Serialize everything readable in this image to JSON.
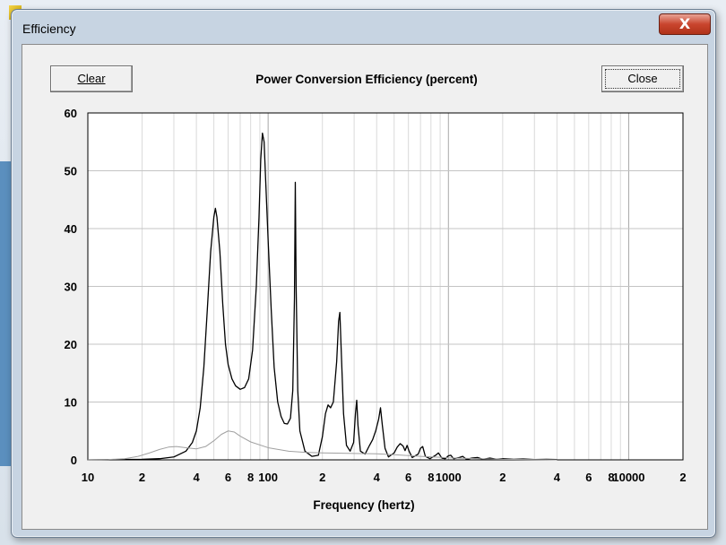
{
  "window": {
    "title": "Efficiency",
    "close_glyph": "X"
  },
  "toolbar": {
    "clear_label": "Clear",
    "close_label": "Close"
  },
  "chart_data": {
    "type": "line",
    "title": "Power Conversion Efficiency (percent)",
    "xlabel": "Frequency (hertz)",
    "ylabel": "",
    "xscale": "log",
    "xlim": [
      10,
      20000
    ],
    "ylim": [
      0,
      60
    ],
    "grid": true,
    "y_ticks": [
      "0",
      "10",
      "20",
      "30",
      "40",
      "50",
      "60"
    ],
    "x_ticks": [
      {
        "value": 10,
        "label": "10"
      },
      {
        "value": 20,
        "label": "2"
      },
      {
        "value": 40,
        "label": "4"
      },
      {
        "value": 60,
        "label": "6"
      },
      {
        "value": 80,
        "label": "8"
      },
      {
        "value": 100,
        "label": "100"
      },
      {
        "value": 200,
        "label": "2"
      },
      {
        "value": 400,
        "label": "4"
      },
      {
        "value": 600,
        "label": "6"
      },
      {
        "value": 800,
        "label": "8"
      },
      {
        "value": 1000,
        "label": "1000"
      },
      {
        "value": 2000,
        "label": "2"
      },
      {
        "value": 4000,
        "label": "4"
      },
      {
        "value": 6000,
        "label": "6"
      },
      {
        "value": 8000,
        "label": "8"
      },
      {
        "value": 10000,
        "label": "10000"
      },
      {
        "value": 20000,
        "label": "2"
      }
    ],
    "series": [
      {
        "color": "#000000",
        "points": [
          [
            10,
            0
          ],
          [
            20,
            0.1
          ],
          [
            25,
            0.2
          ],
          [
            30,
            0.5
          ],
          [
            35,
            1.5
          ],
          [
            38,
            3
          ],
          [
            40,
            5
          ],
          [
            42,
            9
          ],
          [
            44,
            16
          ],
          [
            46,
            26
          ],
          [
            48,
            36
          ],
          [
            50,
            42
          ],
          [
            51,
            43.5
          ],
          [
            52,
            42
          ],
          [
            54,
            36
          ],
          [
            56,
            27
          ],
          [
            58,
            20
          ],
          [
            60,
            16.5
          ],
          [
            63,
            14
          ],
          [
            66,
            12.8
          ],
          [
            70,
            12.2
          ],
          [
            74,
            12.5
          ],
          [
            78,
            14
          ],
          [
            82,
            19
          ],
          [
            86,
            30
          ],
          [
            89,
            42
          ],
          [
            91,
            52
          ],
          [
            93,
            56.5
          ],
          [
            95,
            55
          ],
          [
            97,
            48
          ],
          [
            100,
            38
          ],
          [
            104,
            26
          ],
          [
            108,
            16
          ],
          [
            113,
            10
          ],
          [
            118,
            7.5
          ],
          [
            123,
            6.3
          ],
          [
            128,
            6.2
          ],
          [
            133,
            7.2
          ],
          [
            137,
            12
          ],
          [
            140,
            28
          ],
          [
            141.5,
            48
          ],
          [
            143,
            30
          ],
          [
            146,
            12
          ],
          [
            150,
            5
          ],
          [
            160,
            1.5
          ],
          [
            175,
            0.6
          ],
          [
            190,
            0.8
          ],
          [
            200,
            4
          ],
          [
            208,
            8
          ],
          [
            215,
            9.5
          ],
          [
            222,
            9
          ],
          [
            230,
            10
          ],
          [
            240,
            17
          ],
          [
            246,
            24
          ],
          [
            250,
            25.5
          ],
          [
            255,
            18
          ],
          [
            262,
            8
          ],
          [
            272,
            2.5
          ],
          [
            285,
            1.5
          ],
          [
            298,
            3
          ],
          [
            305,
            8
          ],
          [
            310,
            10.3
          ],
          [
            315,
            6
          ],
          [
            325,
            1.5
          ],
          [
            345,
            1
          ],
          [
            365,
            2.5
          ],
          [
            380,
            3.5
          ],
          [
            395,
            5
          ],
          [
            410,
            7
          ],
          [
            420,
            9
          ],
          [
            430,
            6
          ],
          [
            445,
            2
          ],
          [
            465,
            0.5
          ],
          [
            500,
            1.2
          ],
          [
            520,
            2.2
          ],
          [
            540,
            2.8
          ],
          [
            560,
            2.4
          ],
          [
            575,
            1.6
          ],
          [
            590,
            2.5
          ],
          [
            605,
            1.5
          ],
          [
            630,
            0.4
          ],
          [
            680,
            1
          ],
          [
            700,
            2
          ],
          [
            720,
            2.3
          ],
          [
            745,
            0.6
          ],
          [
            790,
            0.2
          ],
          [
            850,
            0.8
          ],
          [
            880,
            1.2
          ],
          [
            920,
            0.3
          ],
          [
            960,
            0.2
          ],
          [
            1000,
            0.7
          ],
          [
            1030,
            0.8
          ],
          [
            1070,
            0.2
          ],
          [
            1150,
            0.4
          ],
          [
            1200,
            0.6
          ],
          [
            1260,
            0.1
          ],
          [
            1350,
            0.3
          ],
          [
            1450,
            0.4
          ],
          [
            1550,
            0.1
          ],
          [
            1700,
            0.3
          ],
          [
            1850,
            0.1
          ],
          [
            2000,
            0.2
          ],
          [
            2300,
            0.1
          ],
          [
            2600,
            0.15
          ],
          [
            3000,
            0.05
          ],
          [
            3500,
            0.1
          ],
          [
            4000,
            0.05
          ]
        ]
      },
      {
        "color": "#a0a0a0",
        "points": [
          [
            10,
            0
          ],
          [
            13,
            0.05
          ],
          [
            16,
            0.2
          ],
          [
            19,
            0.6
          ],
          [
            22,
            1.2
          ],
          [
            25,
            1.8
          ],
          [
            28,
            2.2
          ],
          [
            31,
            2.3
          ],
          [
            35,
            2.1
          ],
          [
            40,
            1.9
          ],
          [
            45,
            2.3
          ],
          [
            50,
            3.3
          ],
          [
            55,
            4.4
          ],
          [
            60,
            5
          ],
          [
            65,
            4.8
          ],
          [
            70,
            4.1
          ],
          [
            80,
            3.1
          ],
          [
            100,
            2.1
          ],
          [
            130,
            1.5
          ],
          [
            160,
            1.3
          ],
          [
            200,
            1.2
          ],
          [
            300,
            1.1
          ],
          [
            400,
            1.05
          ],
          [
            500,
            0.9
          ],
          [
            700,
            0.6
          ],
          [
            900,
            0.45
          ],
          [
            1000,
            0.35
          ],
          [
            1500,
            0.2
          ],
          [
            2000,
            0.1
          ],
          [
            3000,
            0.03
          ],
          [
            4000,
            0
          ]
        ]
      }
    ]
  }
}
